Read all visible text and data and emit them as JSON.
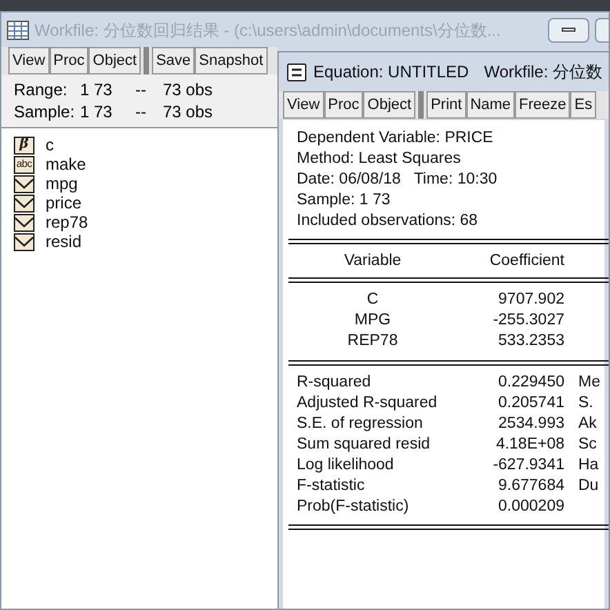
{
  "workfile": {
    "title": "Workfile: 分位数回归结果 - (c:\\users\\admin\\documents\\分位数...",
    "toolbar": [
      "View",
      "Proc",
      "Object",
      "Save",
      "Snapshot"
    ],
    "range": {
      "label": "Range:",
      "value": "1 73",
      "sep": "--",
      "obs": "73 obs"
    },
    "sample": {
      "label": "Sample:",
      "value": "1 73",
      "sep": "--",
      "obs": "73 obs"
    },
    "objects": [
      {
        "name": "c",
        "kind": "coef",
        "icon": "β"
      },
      {
        "name": "make",
        "kind": "alpha",
        "icon": "abc"
      },
      {
        "name": "mpg",
        "kind": "series"
      },
      {
        "name": "price",
        "kind": "series"
      },
      {
        "name": "rep78",
        "kind": "series"
      },
      {
        "name": "resid",
        "kind": "series"
      }
    ]
  },
  "equation": {
    "title": "Equation: UNTITLED",
    "workfile": "Workfile: 分位数",
    "toolbar": [
      "View",
      "Proc",
      "Object",
      "Print",
      "Name",
      "Freeze",
      "Es"
    ],
    "header": [
      "Dependent Variable: PRICE",
      "Method: Least Squares",
      "Date: 06/08/18   Time: 10:30",
      "Sample: 1 73",
      "Included observations: 68"
    ],
    "columns": [
      "Variable",
      "Coefficient"
    ],
    "rows": [
      [
        "C",
        "9707.902"
      ],
      [
        "MPG",
        "-255.3027"
      ],
      [
        "REP78",
        "533.2353"
      ]
    ],
    "stats": [
      [
        "R-squared",
        "0.229450",
        "Me"
      ],
      [
        "Adjusted R-squared",
        "0.205741",
        "S."
      ],
      [
        "S.E. of regression",
        "2534.993",
        "Ak"
      ],
      [
        "Sum squared resid",
        "4.18E+08",
        "Sc"
      ],
      [
        "Log likelihood",
        "-627.9341",
        "Ha"
      ],
      [
        "F-statistic",
        "9.677684",
        "Du"
      ],
      [
        "Prob(F-statistic)",
        "0.000209"
      ]
    ]
  }
}
